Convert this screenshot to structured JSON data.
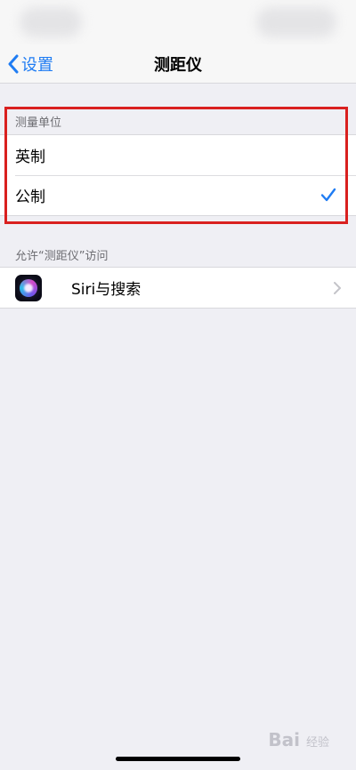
{
  "nav": {
    "back_label": "设置",
    "title": "测距仪"
  },
  "units_section": {
    "header": "测量单位",
    "options": [
      {
        "label": "英制",
        "selected": false
      },
      {
        "label": "公制",
        "selected": true
      }
    ]
  },
  "access_section": {
    "header": "允许“测距仪”访问",
    "items": [
      {
        "label": "Siri与搜索",
        "icon": "siri-icon"
      }
    ]
  },
  "watermark": {
    "brand": "Bai",
    "suffix": "经验"
  },
  "colors": {
    "accent": "#1f7cf3",
    "highlight": "#d9201f"
  }
}
